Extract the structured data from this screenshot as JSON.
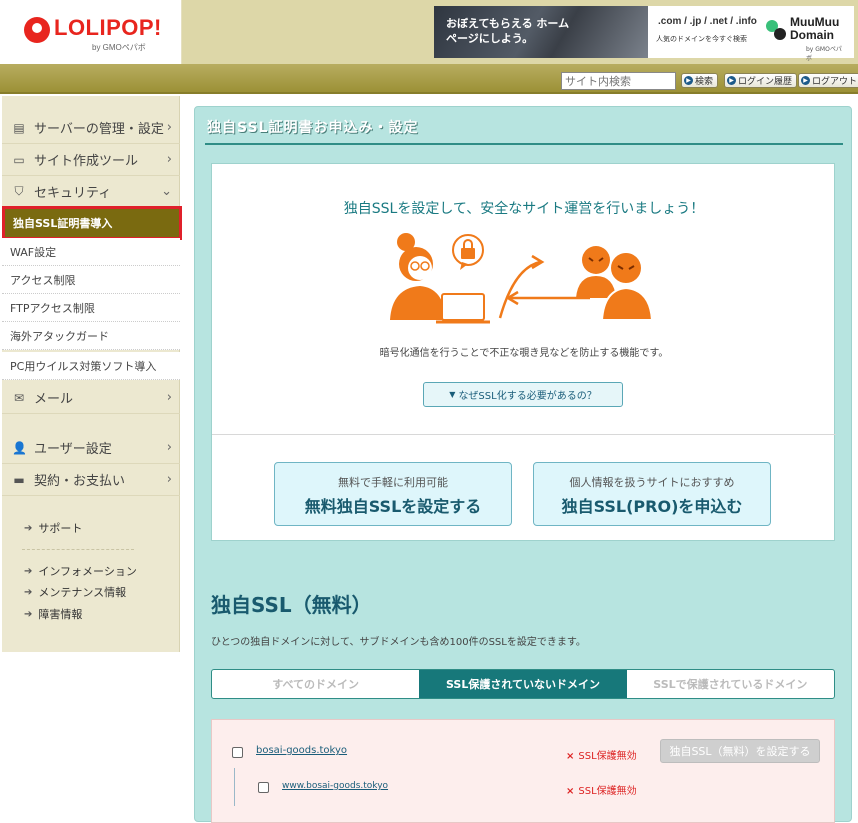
{
  "header": {
    "logo_text": "LOLIPOP!",
    "logo_sub": "by GMOペパボ",
    "banner_left": "おぼえてもらえる ホームページにしよう。",
    "banner_domains": ".com / .jp / .net / .info",
    "banner_tagline": "人気のドメインを今すぐ検索",
    "muumuu_line1": "MuuMuu",
    "muumuu_line2": "Domain",
    "muumuu_sub": "by GMOペパボ"
  },
  "utility": {
    "search_placeholder": "サイト内検索",
    "search_button": "検索",
    "login_history": "ログイン履歴",
    "logout": "ログアウト"
  },
  "sidebar": {
    "server": "サーバーの管理・設定",
    "site_tools": "サイト作成ツール",
    "security": "セキュリティ",
    "sub_items": [
      "独自SSL証明書導入",
      "WAF設定",
      "アクセス制限",
      "FTPアクセス制限",
      "海外アタックガード",
      "PC用ウイルス対策ソフト導入"
    ],
    "mail": "メール",
    "user_settings": "ユーザー設定",
    "billing": "契約・お支払い",
    "support": "サポート",
    "info_links": [
      "インフォメーション",
      "メンテナンス情報",
      "障害情報"
    ]
  },
  "main": {
    "title": "独自SSL証明書お申込み・設定",
    "promo_headline": "独自SSLを設定して、安全なサイト運営を行いましょう！",
    "promo_desc": "暗号化通信を行うことで不正な覗き見などを防止する機能です。",
    "why_button": "なぜSSL化する必要があるの？",
    "free_small": "無料で手軽に利用可能",
    "free_big": "無料独自SSLを設定する",
    "pro_small": "個人情報を扱うサイトにおすすめ",
    "pro_big": "独自SSL(PRO)を申込む",
    "section_title": "独自SSL（無料）",
    "section_desc": "ひとつの独自ドメインに対して、サブドメインも含め100件のSSLを設定できます。",
    "tabs": [
      "すべてのドメイン",
      "SSL保護されていないドメイン",
      "SSLで保護されているドメイン"
    ],
    "domains": [
      {
        "name": "bosai-goods.tokyo",
        "status": "SSL保護無効",
        "button": "独自SSL（無料）を設定する"
      },
      {
        "name": "www.bosai-goods.tokyo",
        "status": "SSL保護無効"
      }
    ]
  },
  "colors": {
    "brand_red": "#e8251e",
    "header_bg": "#ddd7a8",
    "active_sidebar": "#7a6a10",
    "main_bg": "#b7e4e0",
    "illustration_orange": "#f07a1a"
  }
}
